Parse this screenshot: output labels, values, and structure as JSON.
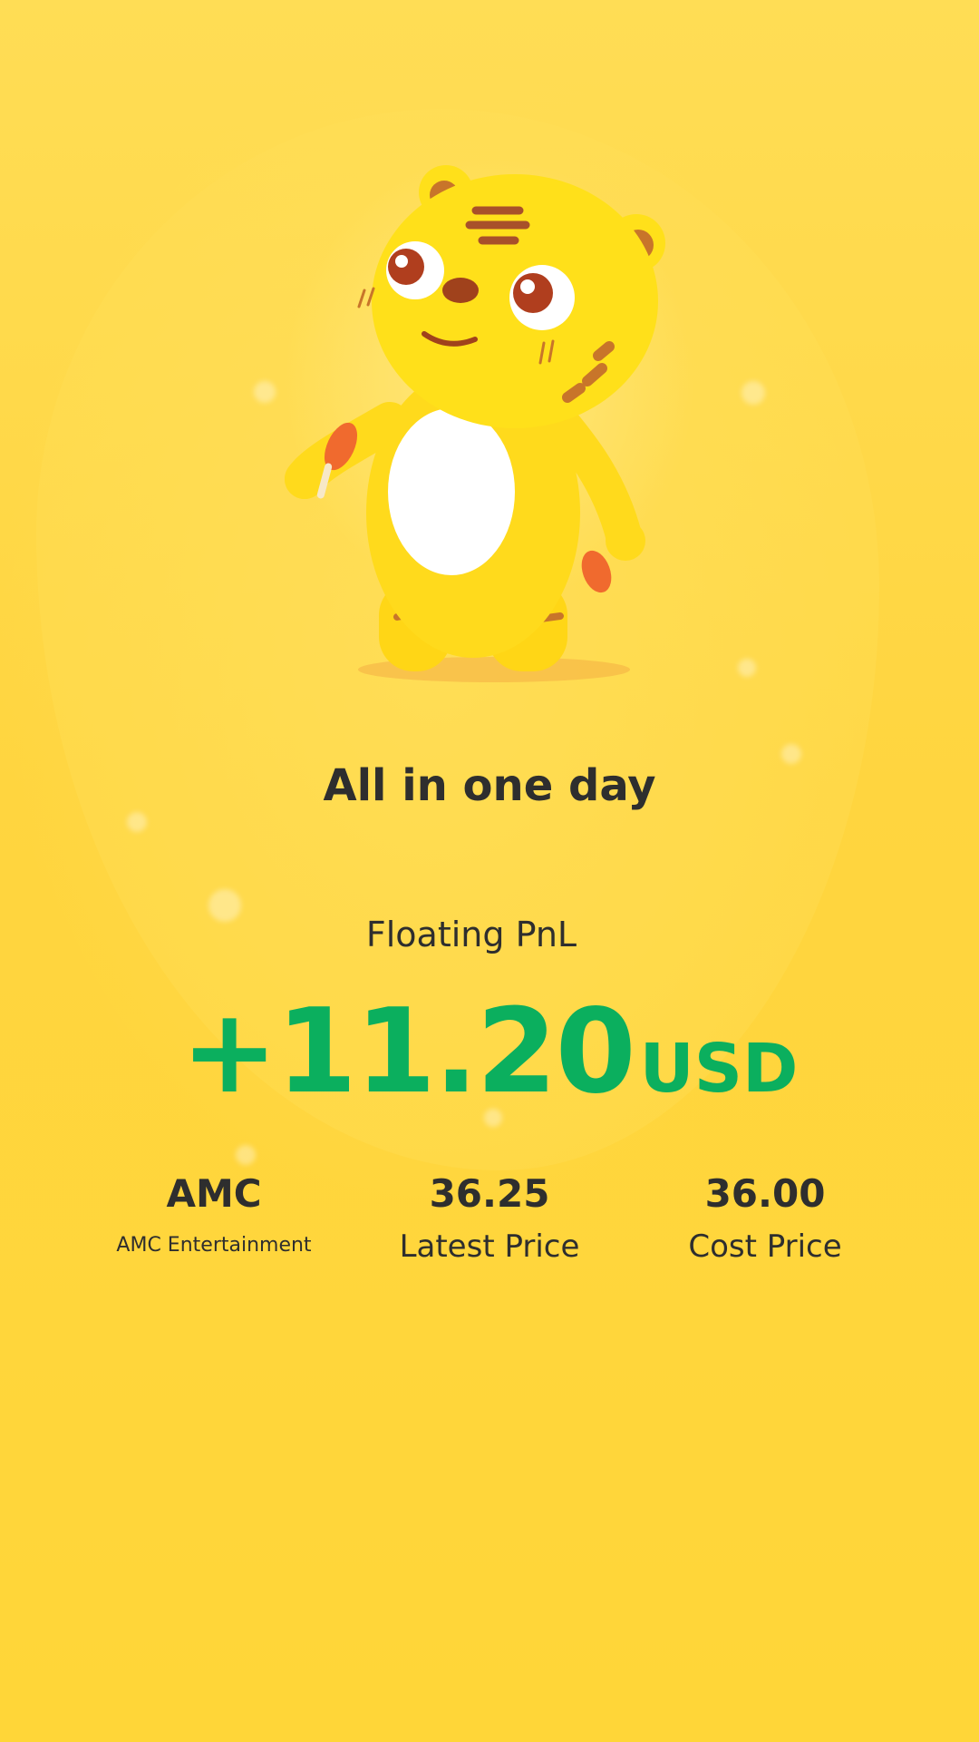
{
  "headline": "All in one day",
  "pnl": {
    "label": "Floating PnL",
    "value": "+11.20",
    "currency": "USD",
    "color": "#0BAF5E"
  },
  "stats": {
    "symbol": {
      "ticker": "AMC",
      "name": "AMC Entertainment"
    },
    "latest_price": {
      "value": "36.25",
      "label": "Latest Price"
    },
    "cost_price": {
      "value": "36.00",
      "label": "Cost Price"
    }
  },
  "mascot": {
    "icon": "tiger-mascot-icon",
    "primary_color": "#FFE01A"
  }
}
